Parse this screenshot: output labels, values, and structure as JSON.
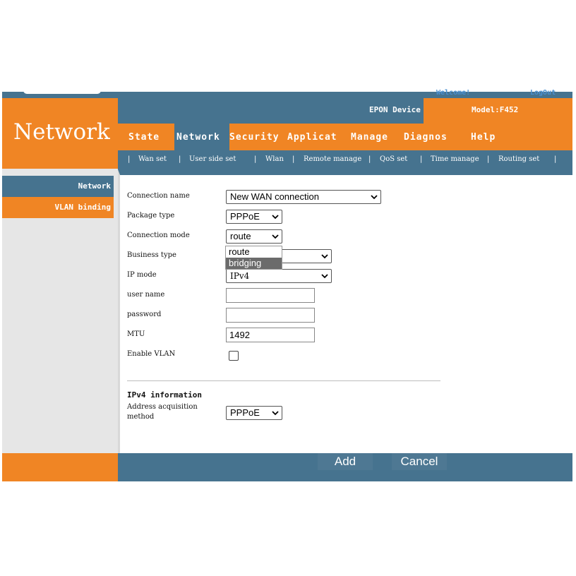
{
  "header": {
    "welcome": "Welcome!",
    "logout": "LogOut",
    "brand_title": "Network",
    "device": "EPON Device",
    "model": "Model:F452"
  },
  "nav": {
    "tabs": [
      "State",
      "Network",
      "Security",
      "Applicat",
      "Manage",
      "Diagnos",
      "Help"
    ],
    "active": "Network"
  },
  "subnav": {
    "items": [
      "Wan set",
      "User side set",
      "Wlan",
      "Remote manage",
      "QoS set",
      "Time manage",
      "Routing set"
    ],
    "separator": "|"
  },
  "sidebar": {
    "items": [
      "Network",
      "VLAN binding"
    ]
  },
  "form": {
    "connection_name": {
      "label": "Connection name",
      "value": "New WAN connection"
    },
    "package_type": {
      "label": "Package type",
      "value": "PPPoE"
    },
    "connection_mode": {
      "label": "Connection mode",
      "value": "route",
      "options": [
        "route",
        "bridging"
      ],
      "highlighted": "bridging"
    },
    "business_type": {
      "label": "Business type",
      "value": ""
    },
    "ip_mode": {
      "label": "IP mode",
      "value": "IPv4"
    },
    "user_name": {
      "label": "user name",
      "value": ""
    },
    "password": {
      "label": "password",
      "value": ""
    },
    "mtu": {
      "label": "MTU",
      "value": "1492"
    },
    "enable_vlan": {
      "label": "Enable VLAN",
      "checked": false
    }
  },
  "ipv4": {
    "heading": "IPv4 information",
    "address_label_line1": "Address acquisition",
    "address_label_line2": "method",
    "address_value": "PPPoE"
  },
  "buttons": {
    "add": "Add",
    "cancel": "Cancel"
  }
}
